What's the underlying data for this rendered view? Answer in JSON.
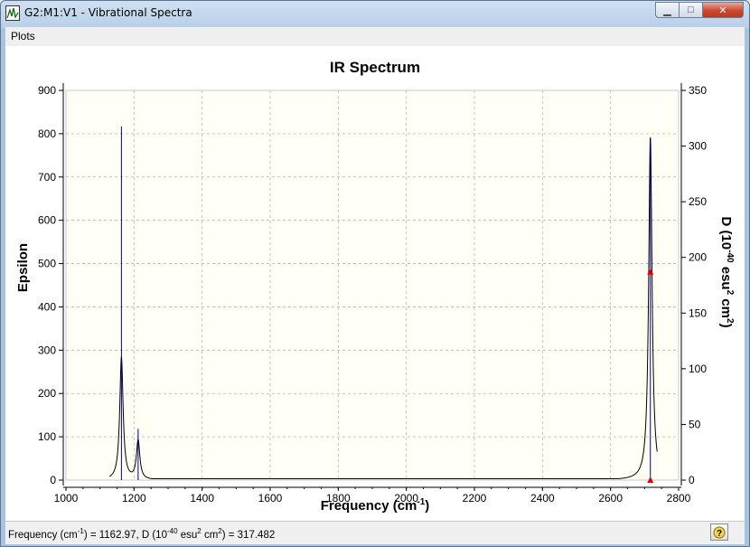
{
  "window": {
    "title": "G2:M1:V1 - Vibrational Spectra",
    "minimize_label": "▁",
    "maximize_label": "□",
    "close_label": "✕"
  },
  "menu": {
    "items": [
      "Plots"
    ]
  },
  "chart_data": {
    "type": "line",
    "title": "IR Spectrum",
    "xlabel": "Frequency (cm-1)",
    "ylabel": "Epsilon",
    "y2label": "D (10-40 esu2 cm2)",
    "xlim": [
      1000,
      2800
    ],
    "ylim": [
      0,
      900
    ],
    "y2lim": [
      0,
      350
    ],
    "x_ticks": [
      1000,
      1200,
      1400,
      1600,
      1800,
      2000,
      2200,
      2400,
      2600,
      2800
    ],
    "y_ticks": [
      0,
      100,
      200,
      300,
      400,
      500,
      600,
      700,
      800,
      900
    ],
    "y2_ticks": [
      0,
      50,
      100,
      150,
      200,
      250,
      300,
      350
    ],
    "grid": true,
    "colors": {
      "spectrum": "#000000",
      "sticks": "#00008b",
      "marker": "#e00000",
      "plot_bg": "#fffff6"
    },
    "series": [
      {
        "name": "",
        "type": "spectrum",
        "peaks": [
          {
            "x": 1162.97,
            "epsilon": 283
          },
          {
            "x": 1212,
            "epsilon": 90
          },
          {
            "x": 2717,
            "epsilon": 792
          }
        ],
        "baseline": 5
      },
      {
        "name": "",
        "type": "sticks",
        "values": [
          {
            "x": 1162.97,
            "D": 317.482
          },
          {
            "x": 1212,
            "D": 46
          },
          {
            "x": 2717,
            "D": 305
          }
        ]
      }
    ],
    "markers": [
      {
        "x": 2717,
        "D": 187
      },
      {
        "x": 2717,
        "D": 0
      }
    ]
  },
  "status": {
    "text": "Frequency (cm-1) = 1162.97, D (10-40 esu2 cm2) = 317.482"
  }
}
